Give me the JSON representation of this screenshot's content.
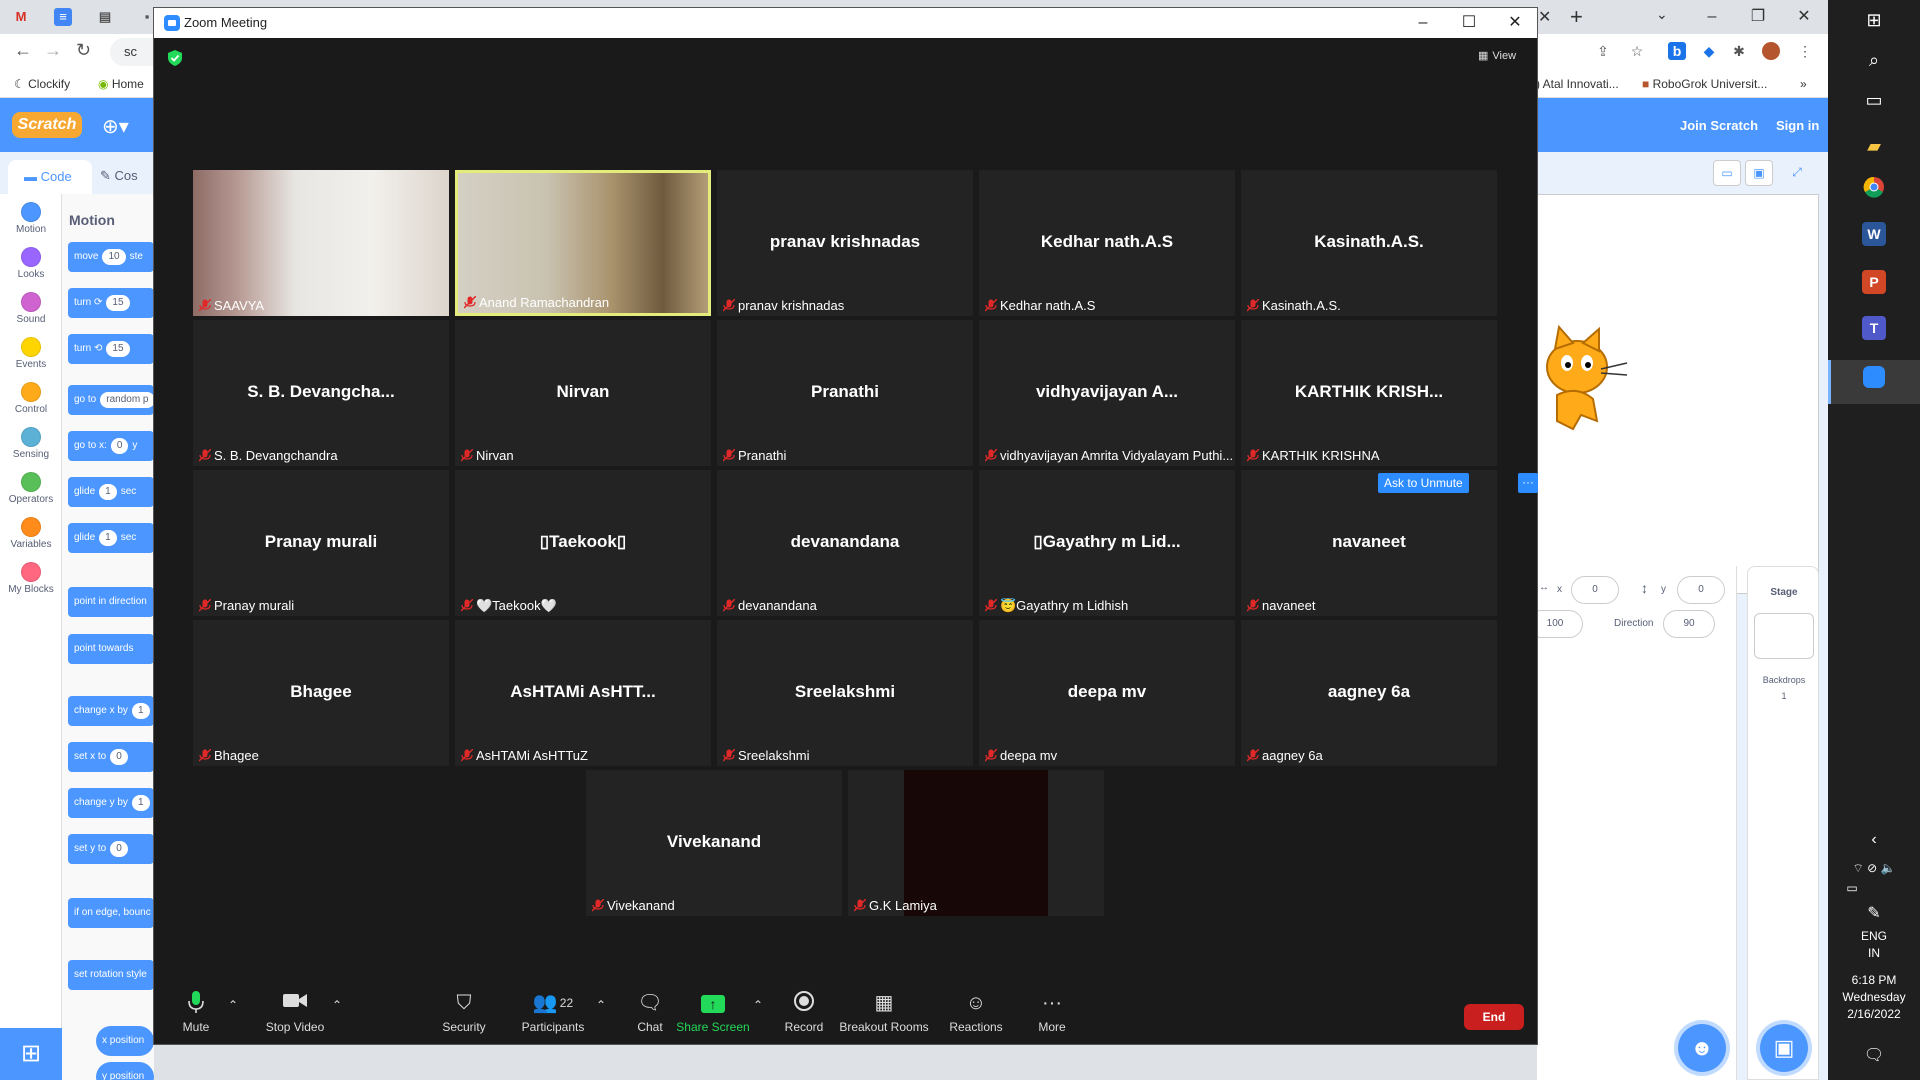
{
  "browser": {
    "tab_right_partial": "",
    "address_partial": "sc",
    "bookmarks": [
      "Clockify",
      "Home",
      ") Atal Innovati...",
      "RoboGrok Universit..."
    ]
  },
  "scratch": {
    "join": "Join Scratch",
    "sign_in": "Sign in",
    "tab_code": "Code",
    "tab_costumes": "Cos",
    "palette_title": "Motion",
    "categories": [
      {
        "label": "Motion",
        "color": "#4c97ff"
      },
      {
        "label": "Looks",
        "color": "#9966ff"
      },
      {
        "label": "Sound",
        "color": "#cf63cf"
      },
      {
        "label": "Events",
        "color": "#ffd500"
      },
      {
        "label": "Control",
        "color": "#ffab19"
      },
      {
        "label": "Sensing",
        "color": "#5cb1d6"
      },
      {
        "label": "Operators",
        "color": "#59c059"
      },
      {
        "label": "Variables",
        "color": "#ff8c1a"
      },
      {
        "label": "My Blocks",
        "color": "#ff6680"
      }
    ],
    "blocks": [
      {
        "text": "move",
        "num": "10",
        "suffix": "ste"
      },
      {
        "text": "turn ⟳",
        "num": "15",
        "suffix": ""
      },
      {
        "text": "turn ⟲",
        "num": "15",
        "suffix": ""
      },
      {
        "text": "go to",
        "num": "random p",
        "suffix": ""
      },
      {
        "text": "go to x:",
        "num": "0",
        "suffix": "y"
      },
      {
        "text": "glide",
        "num": "1",
        "suffix": "sec"
      },
      {
        "text": "glide",
        "num": "1",
        "suffix": "sec"
      },
      {
        "text": "point in direction",
        "num": "",
        "suffix": ""
      },
      {
        "text": "point towards",
        "num": "",
        "suffix": ""
      },
      {
        "text": "change x by",
        "num": "1",
        "suffix": ""
      },
      {
        "text": "set x to",
        "num": "0",
        "suffix": ""
      },
      {
        "text": "change y by",
        "num": "1",
        "suffix": ""
      },
      {
        "text": "set y to",
        "num": "0",
        "suffix": ""
      },
      {
        "text": "if on edge, bounc",
        "num": "",
        "suffix": ""
      },
      {
        "text": "set rotation style",
        "num": "",
        "suffix": ""
      },
      {
        "text": "x position",
        "num": "",
        "suffix": ""
      },
      {
        "text": "y position",
        "num": "",
        "suffix": ""
      }
    ],
    "sprite": {
      "x_label": "x",
      "x_value": "0",
      "y_label": "y",
      "y_value": "0",
      "size_value": "100",
      "direction_label": "Direction",
      "direction_value": "90"
    },
    "stage": {
      "label": "Stage",
      "backdrops_label": "Backdrops",
      "backdrops_count": "1"
    }
  },
  "taskbar": {
    "lang": "ENG",
    "region": "IN",
    "time": "6:18 PM",
    "day": "Wednesday",
    "date": "2/16/2022"
  },
  "zoom": {
    "title": "Zoom Meeting",
    "view_label": "View",
    "ask_unmute": "Ask to Unmute",
    "ask_more": "···",
    "participants": [
      {
        "center": "",
        "label": "SAAVYA",
        "video": "saavya"
      },
      {
        "center": "",
        "label": "Anand Ramachandran",
        "video": "anand",
        "active": true
      },
      {
        "center": "pranav krishnadas",
        "label": "pranav krishnadas"
      },
      {
        "center": "Kedhar nath.A.S",
        "label": "Kedhar nath.A.S"
      },
      {
        "center": "Kasinath.A.S.",
        "label": "Kasinath.A.S."
      },
      {
        "center": "S. B. Devangcha...",
        "label": "S. B. Devangchandra"
      },
      {
        "center": "Nirvan",
        "label": "Nirvan"
      },
      {
        "center": "Pranathi",
        "label": "Pranathi"
      },
      {
        "center": "vidhyavijayan A...",
        "label": "vidhyavijayan Amrita Vidyalayam Puthi..."
      },
      {
        "center": "KARTHIK KRISH...",
        "label": "KARTHIK KRISHNA"
      },
      {
        "center": "Pranay murali",
        "label": "Pranay murali"
      },
      {
        "center": "▯Taekook▯",
        "label": "🤍Taekook🤍"
      },
      {
        "center": "devanandana",
        "label": "devanandana"
      },
      {
        "center": "▯Gayathry m Lid...",
        "label": "😇Gayathry m Lidhish"
      },
      {
        "center": "navaneet",
        "label": "navaneet"
      },
      {
        "center": "Bhagee",
        "label": "Bhagee"
      },
      {
        "center": "AsHTAMi AsHTT...",
        "label": "AsHTAMi AsHTTuZ"
      },
      {
        "center": "Sreelakshmi",
        "label": "Sreelakshmi"
      },
      {
        "center": "deepa mv",
        "label": "deepa mv"
      },
      {
        "center": "aagney 6a",
        "label": "aagney 6a"
      },
      {
        "center": "Vivekanand",
        "label": "Vivekanand"
      },
      {
        "center": "",
        "label": "G.K Lamiya",
        "video": "dark"
      }
    ],
    "toolbar": {
      "mute": "Mute",
      "stop_video": "Stop Video",
      "security": "Security",
      "participants": "Participants",
      "participants_count": "22",
      "chat": "Chat",
      "share_screen": "Share Screen",
      "record": "Record",
      "breakout_rooms": "Breakout Rooms",
      "reactions": "Reactions",
      "more": "More",
      "end": "End"
    },
    "colors": {
      "accent": "#2d8cff",
      "end": "#c91f1f",
      "share": "#23d959",
      "active_border": "#e4ec7c"
    }
  }
}
